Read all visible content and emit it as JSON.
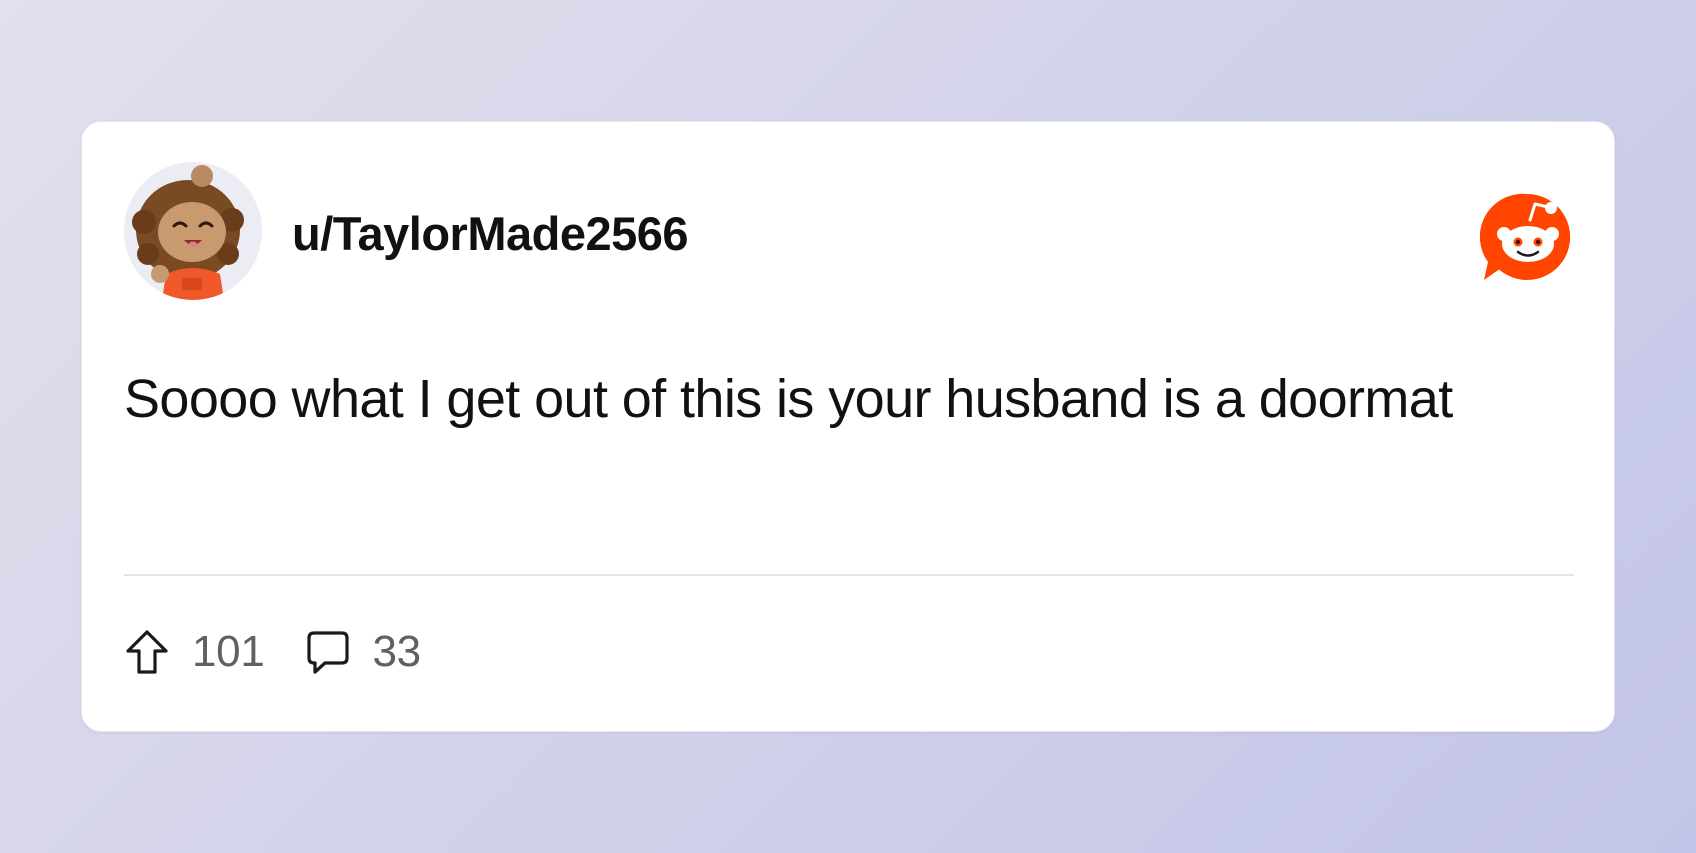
{
  "post": {
    "username": "u/TaylorMade2566",
    "body": "Soooo what I get out of this is your husband is a doormat",
    "upvotes": "101",
    "comments": "33"
  },
  "icons": {
    "avatar": "user-avatar",
    "brand": "reddit-logo-icon",
    "upvote": "upvote-arrow-icon",
    "comment": "comment-bubble-icon"
  },
  "colors": {
    "brand": "#ff4500",
    "text": "#111111",
    "muted": "#5f5f66"
  }
}
